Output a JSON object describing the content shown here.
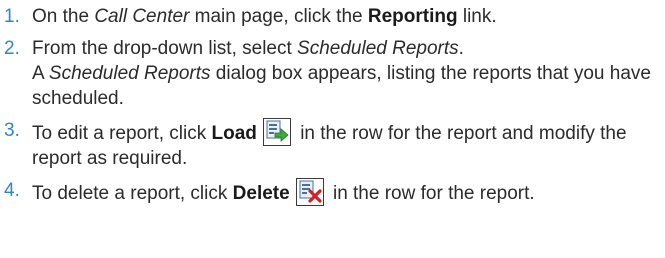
{
  "steps": [
    {
      "number": "1.",
      "parts": [
        "On the ",
        "Call Center",
        " main page, click the ",
        "Reporting",
        " link."
      ]
    },
    {
      "number": "2.",
      "parts": [
        "From the drop-down list, select ",
        "Scheduled Reports",
        ".",
        "A ",
        "Scheduled Reports",
        " dialog box appears, listing the reports that you have scheduled."
      ]
    },
    {
      "number": "3.",
      "parts": [
        "To edit a report, click ",
        "Load",
        " in the row for the report and modify the report as required."
      ]
    },
    {
      "number": "4.",
      "parts": [
        "To delete a report, click ",
        "Delete",
        " in the row for the report."
      ]
    }
  ],
  "icons": {
    "load": "load-report-icon",
    "delete": "delete-report-icon"
  }
}
